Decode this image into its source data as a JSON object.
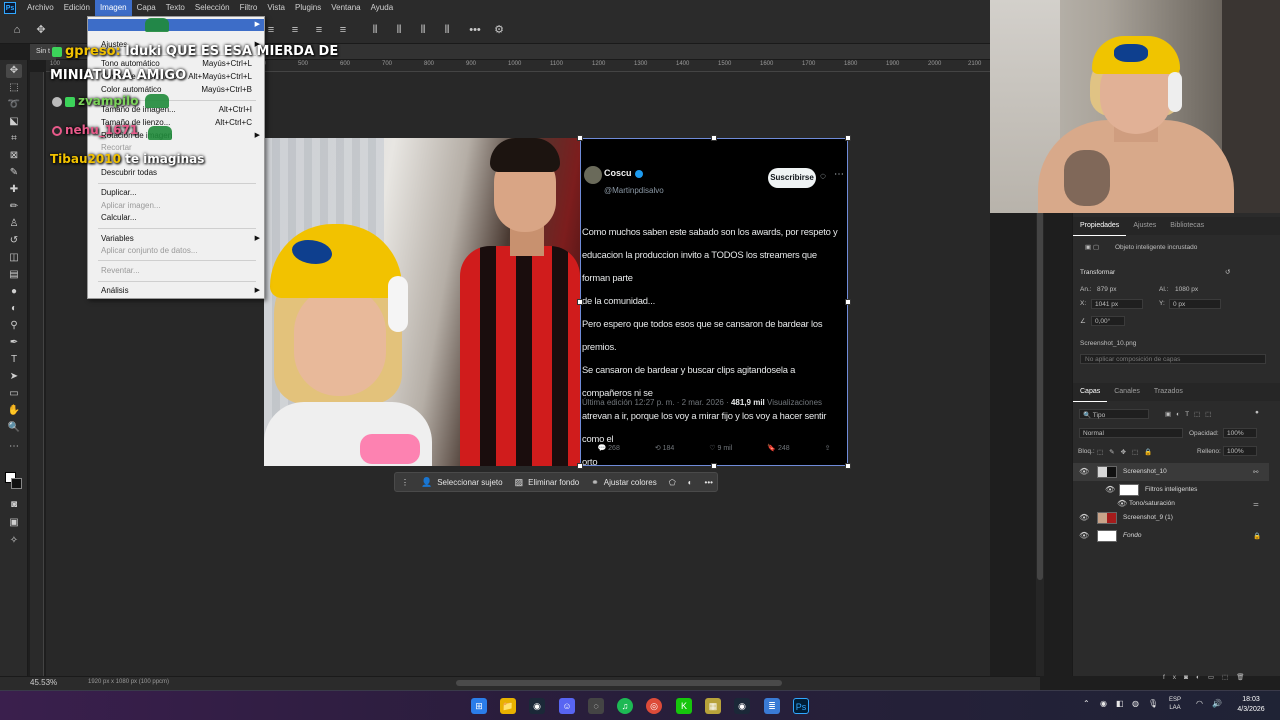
{
  "app": {
    "menu_bar": {
      "items": [
        "Archivo",
        "Edición",
        "Imagen",
        "Capa",
        "Texto",
        "Selección",
        "Filtro",
        "Vista",
        "Plugins",
        "Ventana",
        "Ayuda"
      ],
      "active": "Imagen"
    },
    "document_tab": "Sin t",
    "status": {
      "zoom": "45.53%",
      "dimensions": "1920 px x 1080 px (100 ppcm)"
    },
    "ruler_ticks": [
      "100",
      "0",
      "100",
      "200",
      "300",
      "400",
      "500",
      "600",
      "700",
      "800",
      "900",
      "1000",
      "1100",
      "1200",
      "1300",
      "1400",
      "1500",
      "1600",
      "1700",
      "1800",
      "1900",
      "2000",
      "2100",
      "2200"
    ]
  },
  "image_menu": {
    "items": [
      {
        "label": "Ajustes",
        "shortcut": "",
        "submenu": true,
        "disabled": false
      },
      {
        "label": "Tono automático",
        "shortcut": "Mayús+Ctrl+L",
        "submenu": false,
        "disabled": false
      },
      {
        "label": "Contraste automático",
        "shortcut": "Alt+Mayús+Ctrl+L",
        "submenu": false,
        "disabled": false
      },
      {
        "label": "Color automático",
        "shortcut": "Mayús+Ctrl+B",
        "submenu": false,
        "disabled": false
      },
      {
        "label": "Tamaño de imagen...",
        "shortcut": "Alt+Ctrl+I",
        "submenu": false,
        "disabled": false
      },
      {
        "label": "Tamaño de lienzo...",
        "shortcut": "Alt+Ctrl+C",
        "submenu": false,
        "disabled": false
      },
      {
        "label": "Rotación de imagen",
        "shortcut": "",
        "submenu": true,
        "disabled": false
      },
      {
        "label": "Recortar",
        "shortcut": "",
        "submenu": false,
        "disabled": true
      },
      {
        "label": "Descubrir todas",
        "shortcut": "",
        "submenu": false,
        "disabled": false
      },
      {
        "label": "Duplicar...",
        "shortcut": "",
        "submenu": false,
        "disabled": false
      },
      {
        "label": "Aplicar imagen...",
        "shortcut": "",
        "submenu": false,
        "disabled": true
      },
      {
        "label": "Calcular...",
        "shortcut": "",
        "submenu": false,
        "disabled": false
      },
      {
        "label": "Variables",
        "shortcut": "",
        "submenu": true,
        "disabled": false
      },
      {
        "label": "Aplicar conjunto de datos...",
        "shortcut": "",
        "submenu": false,
        "disabled": true
      },
      {
        "label": "Reventar...",
        "shortcut": "",
        "submenu": false,
        "disabled": true
      },
      {
        "label": "Análisis",
        "shortcut": "",
        "submenu": true,
        "disabled": false
      }
    ]
  },
  "chat_overlay": {
    "line1_user": "gpreso:",
    "line1_text": "lduki QUE ES ESA MIERDA DE",
    "line1_cont": "MINIATURA AMIGO",
    "line2_user": "zvampilo",
    "line3_user": "nehu_1671",
    "line4_user": "Tibau2010",
    "line4_text": "te imaginas"
  },
  "tweet": {
    "name": "Coscu",
    "handle": "@Martinpdisalvo",
    "subscribe_label": "Suscribirse",
    "body": [
      "Como muchos saben este sabado son los awards, por respeto y",
      "educacion la produccion invito a TODOS los streamers que forman parte",
      "de la comunidad...",
      "Pero espero que todos esos que se cansaron de bardear los premios.",
      "Se cansaron de bardear y buscar clips agitandosela a compañeros ni se",
      "atrevan a ir, porque los voy a mirar fijo y los voy a hacer sentir como el",
      "orto"
    ],
    "meta_date": "Última edición 12:27 p. m. · 2 mar. 2026 ·",
    "views_count": "481,9 mil",
    "views_label": "Visualizaciones",
    "actions": {
      "replies": "268",
      "reposts": "184",
      "likes": "9 mil",
      "bookmarks": "248"
    }
  },
  "contextual_taskbar": {
    "select_subject": "Seleccionar sujeto",
    "remove_bg": "Eliminar fondo",
    "adjust_colors": "Ajustar colores"
  },
  "properties_panel": {
    "tabs": [
      "Propiedades",
      "Ajustes",
      "Bibliotecas"
    ],
    "object_type": "Objeto inteligente incrustado",
    "transform_label": "Transformar",
    "width_label": "An.:",
    "width_value": "879 px",
    "height_label": "Al.:",
    "height_value": "1080 px",
    "x_label": "X:",
    "x_value": "1041 px",
    "y_label": "Y:",
    "y_value": "0 px",
    "angle_value": "0,00°",
    "file_name": "Screenshot_10.png",
    "layer_comp": "No aplicar composición de capas"
  },
  "layers_panel": {
    "tabs": [
      "Capas",
      "Canales",
      "Trazados"
    ],
    "filter": "Tipo",
    "blend_mode": "Normal",
    "opacity_label": "Opacidad:",
    "opacity_value": "100%",
    "lock_label": "Bloq.:",
    "fill_label": "Relleno:",
    "fill_value": "100%",
    "layers": [
      {
        "name": "Screenshot_10",
        "selected": true
      },
      {
        "name": "Filtros inteligentes",
        "selected": false
      },
      {
        "name": "Tono/saturación",
        "selected": false
      },
      {
        "name": "Screenshot_9 (1)",
        "selected": false
      },
      {
        "name": "Fondo",
        "selected": false
      }
    ]
  },
  "system_tray": {
    "language_top": "ESP",
    "language_bottom": "LAA",
    "time": "18:03",
    "date": "4/3/2026"
  },
  "colors": {
    "accent": "#3d6dc8",
    "selection": "#6f8bd8",
    "menu_bg": "#f0f0f0"
  }
}
